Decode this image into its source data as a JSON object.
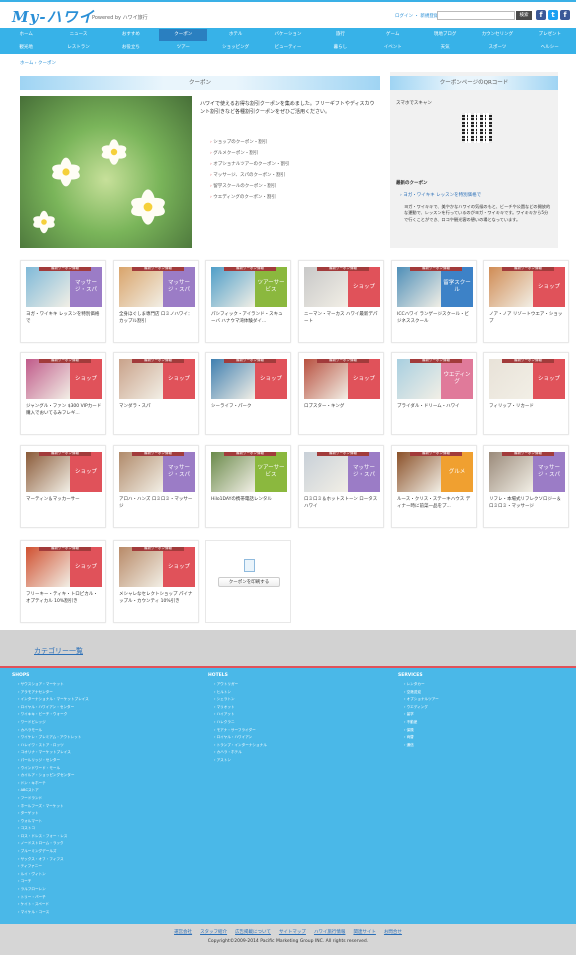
{
  "header": {
    "logo": "My-ハワイ",
    "powered": "Powered by ハワイ旅行",
    "util": "ログイン   ・ 新規登録",
    "search_button": "検索",
    "social": [
      "f",
      "t",
      "f"
    ],
    "social_colors": [
      "#3b5998",
      "#1da1f2",
      "#3b5998"
    ]
  },
  "nav": {
    "row1": [
      "ホーム",
      "ニュース",
      "おすすめ",
      "クーポン",
      "ホテル",
      "バケーション",
      "旅行",
      "ゲーム",
      "現地ブログ",
      "カウンセリング",
      "プレゼント"
    ],
    "row2": [
      "観光地",
      "レストラン",
      "お役立ち",
      "ツアー",
      "ショッピング",
      "ビューティー",
      "暮らし",
      "イベント",
      "天気",
      "スポーツ",
      "ヘルシー"
    ],
    "active": "クーポン"
  },
  "breadcrumb": "ホーム › クーポン",
  "main": {
    "section_title": "クーポン",
    "intro": "ハワイで使えるお得な割引クーポンを集めました。フリーギフトやディスカウント割引きなど各種割引クーポンをぜひご活用ください。",
    "categories": [
      "ショップのクーポン・割引",
      "グルメクーポン・割引",
      "オプショナルツアーのクーポン・割引",
      "マッサージ、スパのクーポン・割引",
      "留学スクールのクーポン・割引",
      "ウエディングのクーポン・割引"
    ]
  },
  "side": {
    "title": "クーポンページのQRコード",
    "scan": "スマホでスキャン",
    "new_title": "最新のクーポン",
    "new_item": "› ヨガ・ワイキキ レッスンを特別価格で",
    "new_text": "ヨガ・ワイキキで、美やかなハワイの気候のもと、ビーチや公園などの開放的な運動で、レッスンを行っているのがヨガ・ワイキキです。ワイキキから5分で行くことができ、ロコや観光客の憩いの場となっています。"
  },
  "tiles": [
    {
      "ribbon": "最新クーポン情報",
      "cat": "マッサージ・スパ",
      "title": "ヨガ・ワイキキ レッスンを特別価格で",
      "color": "#9b7cc6",
      "photo": "#7fb9d8"
    },
    {
      "ribbon": "最新クーポン情報",
      "cat": "マッサージ・スパ",
      "title": "全身ほぐしま専門店 ロミノハワイ：カップル割引",
      "color": "#9b7cc6",
      "photo": "#d9a46b"
    },
    {
      "ribbon": "最新クーポン情報",
      "cat": "ツアーサービス",
      "title": "パシフィック・アイランド・スキューバ ハナウマ湾体験ダイ...",
      "color": "#8bb83e",
      "photo": "#4f9ec8"
    },
    {
      "ribbon": "最新クーポン情報",
      "cat": "ショップ",
      "title": "ニーマン・マーカス ハワイ最新デパート",
      "color": "#e0525a",
      "photo": "#c8c8c8"
    },
    {
      "ribbon": "最新クーポン情報",
      "cat": "留学スクール",
      "title": "ICCハワイ ランゲージスクール・ビジネススクール",
      "color": "#3d82c7",
      "photo": "#4f8fb8"
    },
    {
      "ribbon": "最新クーポン情報",
      "cat": "ショップ",
      "title": "ノア・ノア リゾートウエア・ショップ",
      "color": "#e0525a",
      "photo": "#d08c55"
    },
    {
      "ribbon": "最新クーポン情報",
      "cat": "ショップ",
      "title": "ジャングル・ファン $300 VIPカード購入でおいてるみフレギ...",
      "color": "#e0525a",
      "photo": "#c05a8a"
    },
    {
      "ribbon": "最新クーポン情報",
      "cat": "ショップ",
      "title": "マンダラ・スパ",
      "color": "#e0525a",
      "photo": "#c9a28a"
    },
    {
      "ribbon": "最新クーポン情報",
      "cat": "ショップ",
      "title": "シーライフ・パーク",
      "color": "#e0525a",
      "photo": "#3f7fb0"
    },
    {
      "ribbon": "最新クーポン情報",
      "cat": "ショップ",
      "title": "ロブスター・キング",
      "color": "#e0525a",
      "photo": "#b8503f"
    },
    {
      "ribbon": "最新クーポン情報",
      "cat": "ウエディング",
      "title": "ブライダル・ドリーム・ハワイ",
      "color": "#e07a9a",
      "photo": "#a8cfe0"
    },
    {
      "ribbon": "最新クーポン情報",
      "cat": "ショップ",
      "title": "フィリップ・リカード",
      "color": "#e0525a",
      "photo": "#e8e2d8"
    },
    {
      "ribbon": "最新クーポン情報",
      "cat": "ショップ",
      "title": "マーティン＆マッカーサー",
      "color": "#e0525a",
      "photo": "#8a5a38"
    },
    {
      "ribbon": "最新クーポン情報",
      "cat": "マッサージ・スパ",
      "title": "アロハ・ハンズ ロミロミ・マッサージ",
      "color": "#9b7cc6",
      "photo": "#b08a6a"
    },
    {
      "ribbon": "最新クーポン情報",
      "cat": "ツアーサービス",
      "title": "Hilo1DAYの携帯電話レンタル",
      "color": "#8bb83e",
      "photo": "#6a8a4a"
    },
    {
      "ribbon": "最新クーポン情報",
      "cat": "マッサージ・スパ",
      "title": "ロミロミ＆ホットストーン ロータスハワイ",
      "color": "#9b7cc6",
      "photo": "#c8d0d8"
    },
    {
      "ribbon": "最新クーポン情報",
      "cat": "グルメ",
      "title": "ルース・クリス・ステーキハウス ディナー時に前菜一品をプ...",
      "color": "#f0a030",
      "photo": "#8a5028"
    },
    {
      "ribbon": "最新クーポン情報",
      "cat": "マッサージ・スパ",
      "title": "リフレ・本場式リフレクソロジー＆ロミロミ・マッサージ",
      "color": "#9b7cc6",
      "photo": "#9a8a7a"
    },
    {
      "ribbon": "最新クーポン情報",
      "cat": "ショップ",
      "title": "フリーキー・ティキ・トロピカル・オプティカル 10%割引き",
      "color": "#e0525a",
      "photo": "#d05030"
    },
    {
      "ribbon": "最新クーポン情報",
      "cat": "ショップ",
      "title": "メシャレなセレクトショップ パイナップル・カウンティ 10%引き",
      "color": "#e0525a",
      "photo": "#b88a68"
    }
  ],
  "print": {
    "button": "クーポンを印刷する"
  },
  "category_heading": "カテゴリー一覧",
  "footer": {
    "col1_title": "SHOPS",
    "col1": [
      "サウスショア・マーケット",
      "アラモアナセンター",
      "インターナショナル・マーケットプレイス",
      "ロイヤル・ハワイアン・センター",
      "ワイキキ・ビーチ・ウォーク",
      "ワードビレッジ",
      "カハラモール",
      "ワイケレ・プレミアム・アウトレット",
      "ハレイワ・ストア・ロッツ",
      "コオリナ・マーケットプレイス",
      "パールリッジ・センター",
      "ウインドワード・モール",
      "カイルア・ショッピングセンター",
      "ドン・キホーテ",
      "ABCストア",
      "フードランド",
      "ホールフーズ・マーケット",
      "ターゲット",
      "ウォルマート",
      "コストコ",
      "ロス・ドレス・フォー・レス",
      "ノードストローム・ラック",
      "ブルーミングデールズ",
      "サックス・オフ・フィフス",
      "ティファニー",
      "ルイ・ヴィトン",
      "コーチ",
      "ラルフローレン",
      "トリー・バーチ",
      "ケイト・スペード",
      "マイケル・コース"
    ],
    "col2_title": "HOTELS",
    "col2": [
      "アウトリガー",
      "ヒルトン",
      "シェラトン",
      "マリオット",
      "ハイアット",
      "ハレクラニ",
      "モアナ・サーフライダー",
      "ロイヤル・ハワイアン",
      "トランプ・インターナショナル",
      "カハラ・ホテル",
      "アストン"
    ],
    "col3_title": "SERVICES",
    "col3": [
      "レンタカー",
      "空港送迎",
      "オプショナルツアー",
      "ウエディング",
      "留学",
      "不動産",
      "保険",
      "両替",
      "通信"
    ]
  },
  "bottom": {
    "links": [
      "運営会社",
      "スタッフ紹介",
      "広告掲載について",
      "サイトマップ",
      "ハワイ旅行情報",
      "関連サイト",
      "お問合せ"
    ],
    "copyright": "Copyright©2009-2014 Pacific Marketing Group INC. All rights reserved."
  }
}
